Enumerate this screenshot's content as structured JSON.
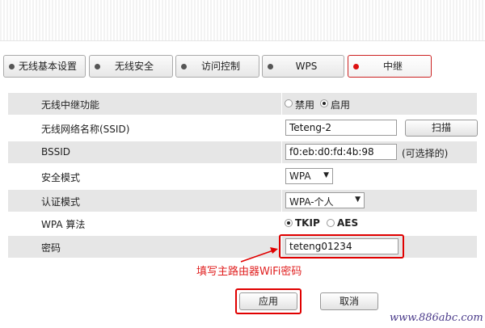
{
  "tabs": [
    {
      "label": "无线基本设置"
    },
    {
      "label": "无线安全"
    },
    {
      "label": "访问控制"
    },
    {
      "label": "WPS"
    },
    {
      "label": "中继"
    }
  ],
  "form": {
    "repeater": {
      "label": "无线中继功能",
      "options": [
        "禁用",
        "启用"
      ],
      "selected": "启用"
    },
    "ssid": {
      "label": "无线网络名称(SSID)",
      "value": "Teteng-2",
      "scan_button": "扫描"
    },
    "bssid": {
      "label": "BSSID",
      "value": "f0:eb:d0:fd:4b:98",
      "hint": "(可选择的)"
    },
    "security_mode": {
      "label": "安全模式",
      "value": "WPA"
    },
    "auth_mode": {
      "label": "认证模式",
      "value": "WPA-个人"
    },
    "wpa_algorithm": {
      "label": "WPA 算法",
      "options": [
        "TKIP",
        "AES"
      ],
      "selected": "TKIP"
    },
    "password": {
      "label": "密码",
      "value": "teteng01234"
    }
  },
  "annotation": {
    "text": "填写主路由器WiFi密码",
    "color": "#e02020"
  },
  "buttons": {
    "apply": "应用",
    "cancel": "取消"
  },
  "watermark": "www.886abc.com",
  "colors": {
    "accent": "#e00000",
    "row_shade": "#e6e6e6"
  }
}
